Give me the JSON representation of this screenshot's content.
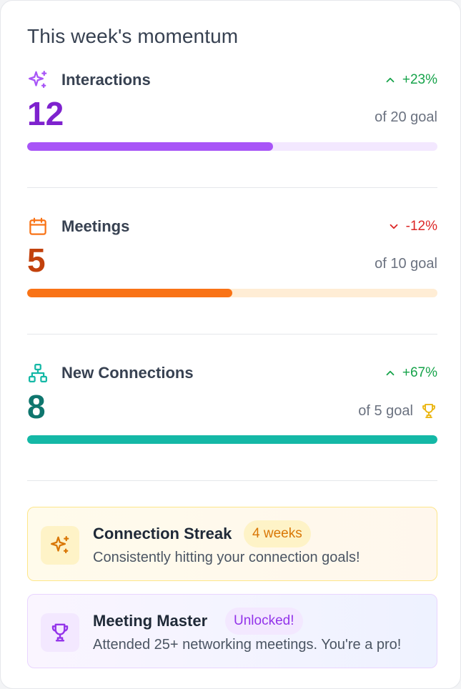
{
  "heading": "This week's momentum",
  "metrics": [
    {
      "label": "Interactions",
      "icon": "sparkles-icon",
      "trend": "+23%",
      "trend_direction": "up",
      "value": "12",
      "goal_text": "of 20 goal",
      "progress": 0.6,
      "color": "#7e22ce",
      "bar_color": "#a855f7",
      "track_color": "#f3e8ff"
    },
    {
      "label": "Meetings",
      "icon": "calendar-icon",
      "trend": "-12%",
      "trend_direction": "down",
      "value": "5",
      "goal_text": "of 10 goal",
      "progress": 0.5,
      "color": "#c2410c",
      "bar_color": "#f97316",
      "track_color": "#ffedd5"
    },
    {
      "label": "New Connections",
      "icon": "network-icon",
      "trend": "+67%",
      "trend_direction": "up",
      "value": "8",
      "goal_text": "of 5 goal",
      "goal_icon": "trophy-icon",
      "progress": 1.0,
      "color": "#0f766e",
      "bar_color": "#14b8a6",
      "track_color": "#ccfbf1"
    }
  ],
  "achievements": [
    {
      "title": "Connection Streak",
      "pill": "4 weeks",
      "description": "Consistently hitting your connection goals!",
      "icon": "sparkles-icon",
      "accent": "#d97706"
    },
    {
      "title": "Meeting Master",
      "pill": "Unlocked!",
      "description": "Attended 25+ networking meetings. You're a pro!",
      "icon": "trophy-icon",
      "accent": "#9333ea"
    }
  ]
}
